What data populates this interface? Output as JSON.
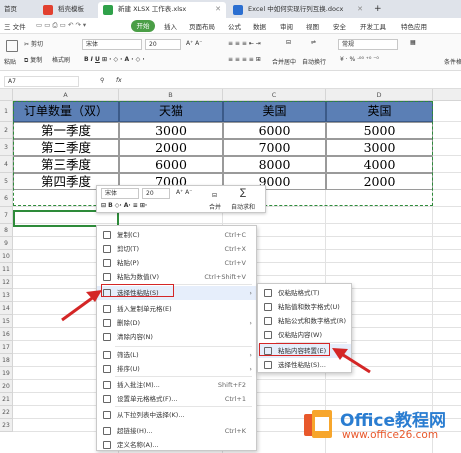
{
  "tabs": [
    {
      "label": "首页"
    },
    {
      "label": "稻壳模板"
    },
    {
      "label": "新建 XLSX 工作表.xlsx"
    },
    {
      "label": "Excel 中如何实现行列互换.docx"
    },
    {
      "label": "+"
    }
  ],
  "menu": {
    "file": "三 文件",
    "items": [
      "开始",
      "插入",
      "页面布局",
      "公式",
      "数据",
      "审阅",
      "视图",
      "安全",
      "开发工具",
      "特色应用"
    ]
  },
  "ribbon": {
    "cut": "剪切",
    "paste": "粘贴",
    "copy": "复制",
    "format_painter": "格式刷",
    "font": "宋体",
    "size": "20",
    "merge": "合并居中",
    "wrap": "自动换行",
    "numfmt": "常规",
    "condfmt": "条件格式"
  },
  "formula": {
    "cellref": "A7",
    "fx": "fx"
  },
  "columns": [
    "A",
    "B",
    "C",
    "D"
  ],
  "rows": [
    "1",
    "2",
    "3",
    "4",
    "5",
    "6",
    "7",
    "8",
    "9",
    "10",
    "11",
    "12",
    "13",
    "14",
    "15",
    "16",
    "17",
    "18",
    "19",
    "20",
    "21",
    "22",
    "23"
  ],
  "table": {
    "header": [
      "订单数量（双）",
      "天猫",
      "美国",
      "英国"
    ],
    "data": [
      [
        "第一季度",
        "3000",
        "6000",
        "5000"
      ],
      [
        "第二季度",
        "2000",
        "7000",
        "3000"
      ],
      [
        "第三季度",
        "6000",
        "8000",
        "4000"
      ],
      [
        "第四季度",
        "7000",
        "9000",
        "2000"
      ]
    ]
  },
  "mini_toolbar": {
    "font": "宋体",
    "size": "20",
    "merge": "合并",
    "autosum": "自动求和"
  },
  "context_menu": [
    {
      "label": "复制(C)",
      "shortcut": "Ctrl+C"
    },
    {
      "label": "剪切(T)",
      "shortcut": "Ctrl+X"
    },
    {
      "label": "粘贴(P)",
      "shortcut": "Ctrl+V"
    },
    {
      "label": "粘贴为数值(V)",
      "shortcut": "Ctrl+Shift+V"
    },
    {
      "label": "选择性粘贴(S)",
      "shortcut": ""
    },
    {
      "label": "插入复制单元格(E)",
      "shortcut": ""
    },
    {
      "label": "删除(D)",
      "shortcut": ""
    },
    {
      "label": "清除内容(N)",
      "shortcut": ""
    },
    {
      "label": "筛选(L)",
      "shortcut": ""
    },
    {
      "label": "排序(U)",
      "shortcut": ""
    },
    {
      "label": "插入批注(M)...",
      "shortcut": "Shift+F2"
    },
    {
      "label": "设置单元格格式(F)...",
      "shortcut": "Ctrl+1"
    },
    {
      "label": "从下拉列表中选择(K)...",
      "shortcut": ""
    },
    {
      "label": "超链接(H)...",
      "shortcut": "Ctrl+K"
    },
    {
      "label": "定义名称(A)...",
      "shortcut": ""
    }
  ],
  "submenu": [
    {
      "label": "仅粘贴格式(T)"
    },
    {
      "label": "粘贴值和数字格式(U)"
    },
    {
      "label": "粘贴公式和数字格式(R)"
    },
    {
      "label": "仅粘贴内容(W)"
    },
    {
      "label": "粘贴内容转置(E)"
    },
    {
      "label": "选择性粘贴(S)..."
    }
  ],
  "watermark": {
    "brand": "Office教程网",
    "url": "www.office26.com"
  },
  "colors": {
    "accent": "#4a9e46",
    "header_fill": "#5b7fb5",
    "highlight": "#d42626"
  }
}
